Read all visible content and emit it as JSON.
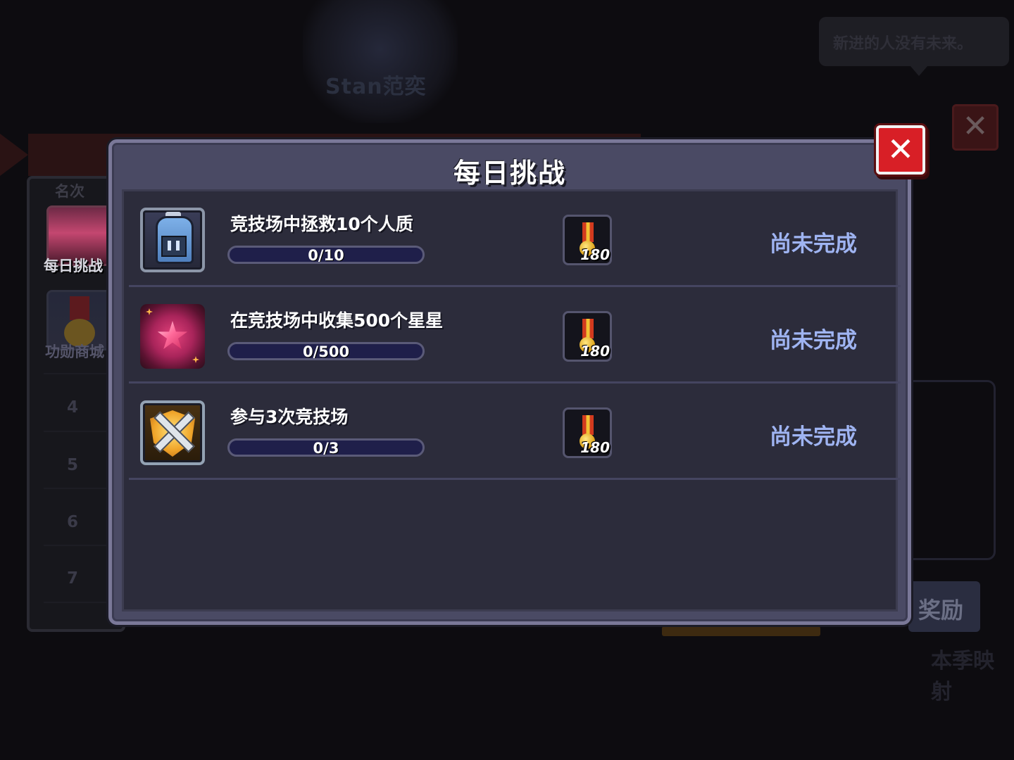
{
  "background": {
    "player_name": "Stan范奕",
    "speech_bubble": "新进的人没有未来。",
    "rank_header": "名次",
    "side_menu": [
      {
        "label": "每日挑战"
      },
      {
        "label": "功勋商城"
      }
    ],
    "rank_numbers": [
      "4",
      "5",
      "6",
      "7"
    ],
    "reward_button": "奖励",
    "bottom_text": "本季映射"
  },
  "modal": {
    "title": "每日挑战",
    "close_label": "✕",
    "tasks": [
      {
        "icon": "helmet-icon",
        "title": "竞技场中拯救10个人质",
        "progress_text": "0/10",
        "progress_fraction": 0,
        "reward_icon": "medal-icon",
        "reward_amount": "180",
        "status": "尚未完成"
      },
      {
        "icon": "star-gem-icon",
        "title": "在竞技场中收集500个星星",
        "progress_text": "0/500",
        "progress_fraction": 0,
        "reward_icon": "medal-icon",
        "reward_amount": "180",
        "status": "尚未完成"
      },
      {
        "icon": "crossed-swords-icon",
        "title": "参与3次竞技场",
        "progress_text": "0/3",
        "progress_fraction": 0,
        "reward_icon": "medal-icon",
        "reward_amount": "180",
        "status": "尚未完成"
      }
    ]
  },
  "colors": {
    "status_text": "#9fb4f2",
    "close_button": "#d81f26",
    "modal_frame": "#4a4a64",
    "progress_track": "#1f1f4a"
  }
}
